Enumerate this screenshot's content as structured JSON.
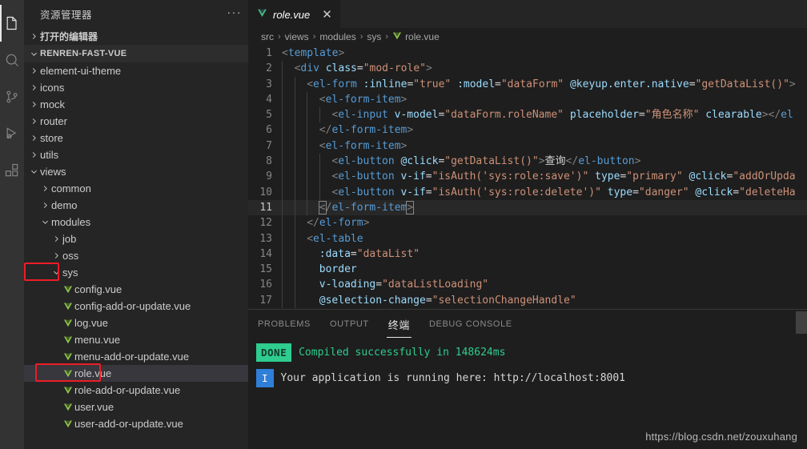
{
  "activitybar": {
    "items": [
      {
        "name": "explorer-icon",
        "label": "Explorer",
        "active": true
      },
      {
        "name": "search-icon",
        "label": "Search",
        "active": false
      },
      {
        "name": "source-control-icon",
        "label": "Source Control",
        "active": false
      },
      {
        "name": "run-debug-icon",
        "label": "Run and Debug",
        "active": false
      },
      {
        "name": "extensions-icon",
        "label": "Extensions",
        "active": false
      }
    ]
  },
  "sidebar": {
    "title": "资源管理器",
    "more_actions": "···",
    "open_editors": "打开的编辑器",
    "project_name": "RENREN-FAST-VUE",
    "tree": [
      {
        "label": "element-ui-theme",
        "depth": 1,
        "kind": "folder",
        "expanded": false
      },
      {
        "label": "icons",
        "depth": 1,
        "kind": "folder",
        "expanded": false
      },
      {
        "label": "mock",
        "depth": 1,
        "kind": "folder",
        "expanded": false
      },
      {
        "label": "router",
        "depth": 1,
        "kind": "folder",
        "expanded": false
      },
      {
        "label": "store",
        "depth": 1,
        "kind": "folder",
        "expanded": false
      },
      {
        "label": "utils",
        "depth": 1,
        "kind": "folder",
        "expanded": false
      },
      {
        "label": "views",
        "depth": 1,
        "kind": "folder",
        "expanded": true
      },
      {
        "label": "common",
        "depth": 2,
        "kind": "folder",
        "expanded": false
      },
      {
        "label": "demo",
        "depth": 2,
        "kind": "folder",
        "expanded": false
      },
      {
        "label": "modules",
        "depth": 2,
        "kind": "folder",
        "expanded": true
      },
      {
        "label": "job",
        "depth": 3,
        "kind": "folder",
        "expanded": false
      },
      {
        "label": "oss",
        "depth": 3,
        "kind": "folder",
        "expanded": false
      },
      {
        "label": "sys",
        "depth": 3,
        "kind": "folder",
        "expanded": true,
        "annotated": true
      },
      {
        "label": "config.vue",
        "depth": 4,
        "kind": "vue"
      },
      {
        "label": "config-add-or-update.vue",
        "depth": 4,
        "kind": "vue"
      },
      {
        "label": "log.vue",
        "depth": 4,
        "kind": "vue"
      },
      {
        "label": "menu.vue",
        "depth": 4,
        "kind": "vue"
      },
      {
        "label": "menu-add-or-update.vue",
        "depth": 4,
        "kind": "vue"
      },
      {
        "label": "role.vue",
        "depth": 4,
        "kind": "vue",
        "selected": true,
        "annotated": true
      },
      {
        "label": "role-add-or-update.vue",
        "depth": 4,
        "kind": "vue"
      },
      {
        "label": "user.vue",
        "depth": 4,
        "kind": "vue"
      },
      {
        "label": "user-add-or-update.vue",
        "depth": 4,
        "kind": "vue"
      }
    ]
  },
  "editor": {
    "tab": {
      "label": "role.vue",
      "icon": "vue-icon",
      "close": "✕",
      "preview": true
    },
    "breadcrumb": [
      "src",
      "views",
      "modules",
      "sys",
      "role.vue"
    ],
    "breadcrumb_separator": "›",
    "first_line_number": 1,
    "current_line": 11,
    "lines": [
      {
        "n": 1,
        "indent": 0,
        "guides": 0,
        "tokens": [
          [
            "t-punc",
            "<"
          ],
          [
            "t-tag",
            "template"
          ],
          [
            "t-punc",
            ">"
          ]
        ]
      },
      {
        "n": 2,
        "indent": 2,
        "guides": 1,
        "tokens": [
          [
            "t-punc",
            "<"
          ],
          [
            "t-tag",
            "div"
          ],
          [
            "t-txt",
            " "
          ],
          [
            "t-attr",
            "class"
          ],
          [
            "t-eq",
            "="
          ],
          [
            "t-str",
            "\"mod-role\""
          ],
          [
            "t-punc",
            ">"
          ]
        ]
      },
      {
        "n": 3,
        "indent": 4,
        "guides": 2,
        "tokens": [
          [
            "t-punc",
            "<"
          ],
          [
            "t-tag",
            "el-form"
          ],
          [
            "t-txt",
            " "
          ],
          [
            "t-attr",
            ":inline"
          ],
          [
            "t-eq",
            "="
          ],
          [
            "t-str",
            "\"true\""
          ],
          [
            "t-txt",
            " "
          ],
          [
            "t-attr",
            ":model"
          ],
          [
            "t-eq",
            "="
          ],
          [
            "t-str",
            "\"dataForm\""
          ],
          [
            "t-txt",
            " "
          ],
          [
            "t-attr",
            "@keyup.enter.native"
          ],
          [
            "t-eq",
            "="
          ],
          [
            "t-str",
            "\"getDataList()\""
          ],
          [
            "t-punc",
            ">"
          ]
        ]
      },
      {
        "n": 4,
        "indent": 6,
        "guides": 3,
        "tokens": [
          [
            "t-punc",
            "<"
          ],
          [
            "t-tag",
            "el-form-item"
          ],
          [
            "t-punc",
            ">"
          ]
        ]
      },
      {
        "n": 5,
        "indent": 8,
        "guides": 4,
        "tokens": [
          [
            "t-punc",
            "<"
          ],
          [
            "t-tag",
            "el-input"
          ],
          [
            "t-txt",
            " "
          ],
          [
            "t-attr",
            "v-model"
          ],
          [
            "t-eq",
            "="
          ],
          [
            "t-str",
            "\"dataForm.roleName\""
          ],
          [
            "t-txt",
            " "
          ],
          [
            "t-attr",
            "placeholder"
          ],
          [
            "t-eq",
            "="
          ],
          [
            "t-str",
            "\"角色名称\""
          ],
          [
            "t-txt",
            " "
          ],
          [
            "t-attr",
            "clearable"
          ],
          [
            "t-punc",
            "></"
          ],
          [
            "t-tag",
            "el"
          ]
        ]
      },
      {
        "n": 6,
        "indent": 6,
        "guides": 3,
        "tokens": [
          [
            "t-punc",
            "</"
          ],
          [
            "t-tag",
            "el-form-item"
          ],
          [
            "t-punc",
            ">"
          ]
        ]
      },
      {
        "n": 7,
        "indent": 6,
        "guides": 3,
        "tokens": [
          [
            "t-punc",
            "<"
          ],
          [
            "t-tag",
            "el-form-item"
          ],
          [
            "t-punc",
            ">"
          ]
        ]
      },
      {
        "n": 8,
        "indent": 8,
        "guides": 4,
        "tokens": [
          [
            "t-punc",
            "<"
          ],
          [
            "t-tag",
            "el-button"
          ],
          [
            "t-txt",
            " "
          ],
          [
            "t-attr",
            "@click"
          ],
          [
            "t-eq",
            "="
          ],
          [
            "t-str",
            "\"getDataList()\""
          ],
          [
            "t-punc",
            ">"
          ],
          [
            "t-txt",
            "查询"
          ],
          [
            "t-punc",
            "</"
          ],
          [
            "t-tag",
            "el-button"
          ],
          [
            "t-punc",
            ">"
          ]
        ]
      },
      {
        "n": 9,
        "indent": 8,
        "guides": 4,
        "tokens": [
          [
            "t-punc",
            "<"
          ],
          [
            "t-tag",
            "el-button"
          ],
          [
            "t-txt",
            " "
          ],
          [
            "t-attr",
            "v-if"
          ],
          [
            "t-eq",
            "="
          ],
          [
            "t-str",
            "\"isAuth('sys:role:save')\""
          ],
          [
            "t-txt",
            " "
          ],
          [
            "t-attr",
            "type"
          ],
          [
            "t-eq",
            "="
          ],
          [
            "t-str",
            "\"primary\""
          ],
          [
            "t-txt",
            " "
          ],
          [
            "t-attr",
            "@click"
          ],
          [
            "t-eq",
            "="
          ],
          [
            "t-str",
            "\"addOrUpda"
          ]
        ]
      },
      {
        "n": 10,
        "indent": 8,
        "guides": 4,
        "tokens": [
          [
            "t-punc",
            "<"
          ],
          [
            "t-tag",
            "el-button"
          ],
          [
            "t-txt",
            " "
          ],
          [
            "t-attr",
            "v-if"
          ],
          [
            "t-eq",
            "="
          ],
          [
            "t-str",
            "\"isAuth('sys:role:delete')\""
          ],
          [
            "t-txt",
            " "
          ],
          [
            "t-attr",
            "type"
          ],
          [
            "t-eq",
            "="
          ],
          [
            "t-str",
            "\"danger\""
          ],
          [
            "t-txt",
            " "
          ],
          [
            "t-attr",
            "@click"
          ],
          [
            "t-eq",
            "="
          ],
          [
            "t-str",
            "\"deleteHa"
          ]
        ]
      },
      {
        "n": 11,
        "indent": 6,
        "guides": 3,
        "current": true,
        "tokens": [
          [
            "t-punc bracket-box",
            "<"
          ],
          [
            "t-punc",
            "/"
          ],
          [
            "t-tag",
            "el-form-item"
          ],
          [
            "t-punc bracket-box",
            ">"
          ]
        ]
      },
      {
        "n": 12,
        "indent": 4,
        "guides": 2,
        "tokens": [
          [
            "t-punc",
            "</"
          ],
          [
            "t-tag",
            "el-form"
          ],
          [
            "t-punc",
            ">"
          ]
        ]
      },
      {
        "n": 13,
        "indent": 4,
        "guides": 2,
        "tokens": [
          [
            "t-punc",
            "<"
          ],
          [
            "t-tag",
            "el-table"
          ]
        ]
      },
      {
        "n": 14,
        "indent": 6,
        "guides": 2,
        "tokens": [
          [
            "t-attr",
            ":data"
          ],
          [
            "t-eq",
            "="
          ],
          [
            "t-str",
            "\"dataList\""
          ]
        ]
      },
      {
        "n": 15,
        "indent": 6,
        "guides": 2,
        "tokens": [
          [
            "t-attr",
            "border"
          ]
        ]
      },
      {
        "n": 16,
        "indent": 6,
        "guides": 2,
        "tokens": [
          [
            "t-attr",
            "v-loading"
          ],
          [
            "t-eq",
            "="
          ],
          [
            "t-str",
            "\"dataListLoading\""
          ]
        ]
      },
      {
        "n": 17,
        "indent": 6,
        "guides": 2,
        "tokens": [
          [
            "t-attr",
            "@selection-change"
          ],
          [
            "t-eq",
            "="
          ],
          [
            "t-str",
            "\"selectionChangeHandle\""
          ]
        ]
      }
    ]
  },
  "panel": {
    "tabs": [
      {
        "label": "PROBLEMS",
        "active": false,
        "cn": false
      },
      {
        "label": "OUTPUT",
        "active": false,
        "cn": false
      },
      {
        "label": "终端",
        "active": true,
        "cn": true
      },
      {
        "label": "DEBUG CONSOLE",
        "active": false,
        "cn": false
      }
    ],
    "terminal": {
      "done_badge": "DONE",
      "done_text": "Compiled successfully in 148624ms",
      "info_badge": "I",
      "info_text": "Your application is running here: http://localhost:8001"
    }
  },
  "watermark": "https://blog.csdn.net/zouxuhang",
  "colors": {
    "activity_bar_bg": "#333333",
    "sidebar_bg": "#252526",
    "editor_bg": "#1e1e1e",
    "selection_bg": "#37373d",
    "annotation_red": "#ee1c25",
    "vue_green": "#8bc34a",
    "done_green": "#2ecc8f",
    "info_blue": "#2f7fd8",
    "tag_blue": "#569cd6",
    "attr_blue": "#9cdcfe",
    "string_orange": "#ce9178"
  }
}
